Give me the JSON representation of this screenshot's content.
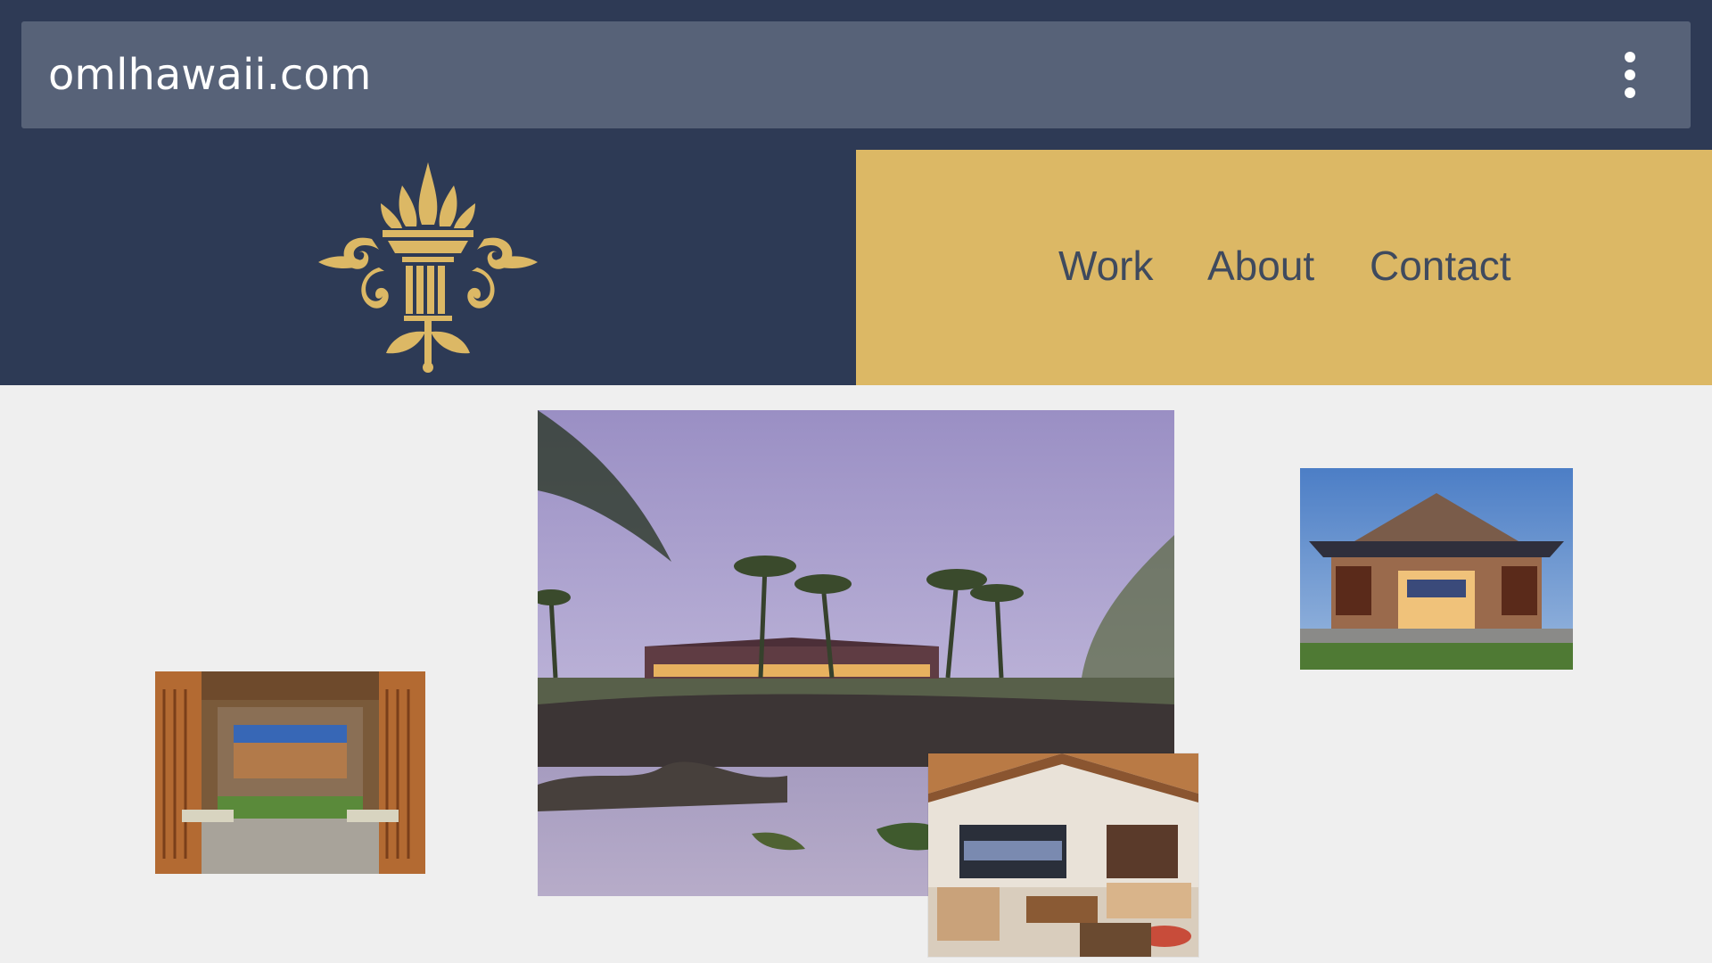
{
  "browser": {
    "url": "omlhawaii.com",
    "menu_icon": "kebab-menu-icon"
  },
  "header": {
    "logo_icon": "torch-column-crest-icon",
    "nav": [
      {
        "label": "Work"
      },
      {
        "label": "About"
      },
      {
        "label": "Contact"
      }
    ]
  },
  "colors": {
    "chrome_bg": "#2e3a55",
    "urlbar_bg": "#576278",
    "brand_bg": "#2d3a55",
    "nav_bg": "#dcb865",
    "logo_gold": "#dcb865",
    "nav_text": "#3f4a5e",
    "page_bg": "#efefef"
  },
  "gallery": [
    {
      "name": "resort-lagoon-dusk-photo"
    },
    {
      "name": "entry-hall-benches-photo"
    },
    {
      "name": "pavilion-exterior-photo"
    },
    {
      "name": "living-room-interior-photo"
    }
  ]
}
